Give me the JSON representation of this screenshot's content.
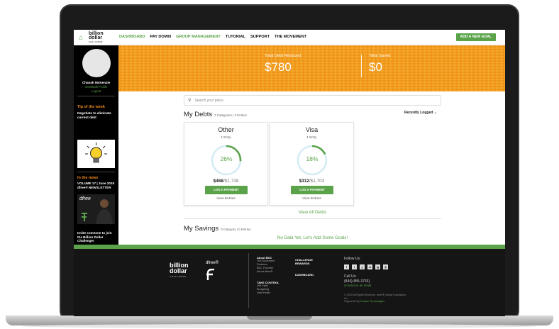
{
  "nav": {
    "logo_line1": "billion",
    "logo_line2": "dollar",
    "logo_sub": "CHALLENGE",
    "items": [
      "DASHBOARD",
      "PAY DOWN",
      "GROUP MANAGEMENT",
      "TUTORIAL",
      "SUPPORT",
      "THE MOVEMENT"
    ],
    "cta": "ADD A NEW GOAL"
  },
  "sidebar": {
    "user_name": "Chanah McKenzie",
    "edit_profile": "View/Edit Profile",
    "logout": "Logout",
    "tip_heading": "Tip of the week",
    "tip_text": "Negotiate to eliminate current debt",
    "news_heading": "In the news",
    "news_text": "VOLUME 17 | June 2019 dfree® NEWSLETTER",
    "news_brand": "dfree",
    "invite_text": "Invite someone to join the Billion Dollar Challenge!",
    "social": [
      "f",
      "t",
      "y",
      "in",
      "ig"
    ]
  },
  "banner": {
    "total_debt_label": "Total Debt Reduced",
    "total_debt_value": "$780",
    "total_saved_label": "Total Saved",
    "total_saved_value": "$0"
  },
  "search": {
    "placeholder": "Search your plans"
  },
  "debts": {
    "title": "My Debts",
    "meta": "3 Categories  |  2 Entries",
    "sort_label": "Recently Logged ⌄",
    "cards": [
      {
        "name": "Other",
        "entries": "1 Entry",
        "percent": 26,
        "percent_label": "26%",
        "paid": "$468",
        "total": "/$1,738",
        "button": "LOG A PAYMENT",
        "link": "View Entries"
      },
      {
        "name": "Visa",
        "entries": "1 Entry",
        "percent": 18,
        "percent_label": "18%",
        "paid": "$312",
        "total": "/$1,703",
        "button": "LOG A PAYMENT",
        "link": "View Entries"
      }
    ],
    "view_all": "View All Debts"
  },
  "savings": {
    "title": "My Savings",
    "meta": "0 Category  |  0 Entries",
    "empty": "No Data Yet, Let's Add Some Goals!"
  },
  "footer": {
    "logo_line1": "billion",
    "logo_line2": "dollar",
    "logo_sub": "CHALLENGE",
    "dfree": "dfree®",
    "about_head": "About BDC",
    "about_items": [
      "The Movement",
      "Partners",
      "BDC Founder",
      "About dfree®"
    ],
    "take_control_head": "TAKE CONTROL",
    "take_control_items": [
      "Life Style",
      "Budgeting",
      "Debt Relief"
    ],
    "challenge_head": "CHALLENGE REWARDS",
    "dashboard_head": "DASHBOARD",
    "follow": "Follow Us:",
    "social": [
      "f",
      "t",
      "y",
      "in",
      "ig",
      "◎"
    ],
    "call": "Call Us:",
    "phone": "(844)-855-3733)",
    "email": "or send us an email",
    "copyright": "© 2019 All Rights Reserved. dfree® Global Foundation, Inc.",
    "supported_prefix": "Supported by ",
    "supported_by": "Enviyan Technologies"
  },
  "colors": {
    "green": "#5aa34a",
    "orange": "#f39313",
    "dark": "#151515"
  }
}
